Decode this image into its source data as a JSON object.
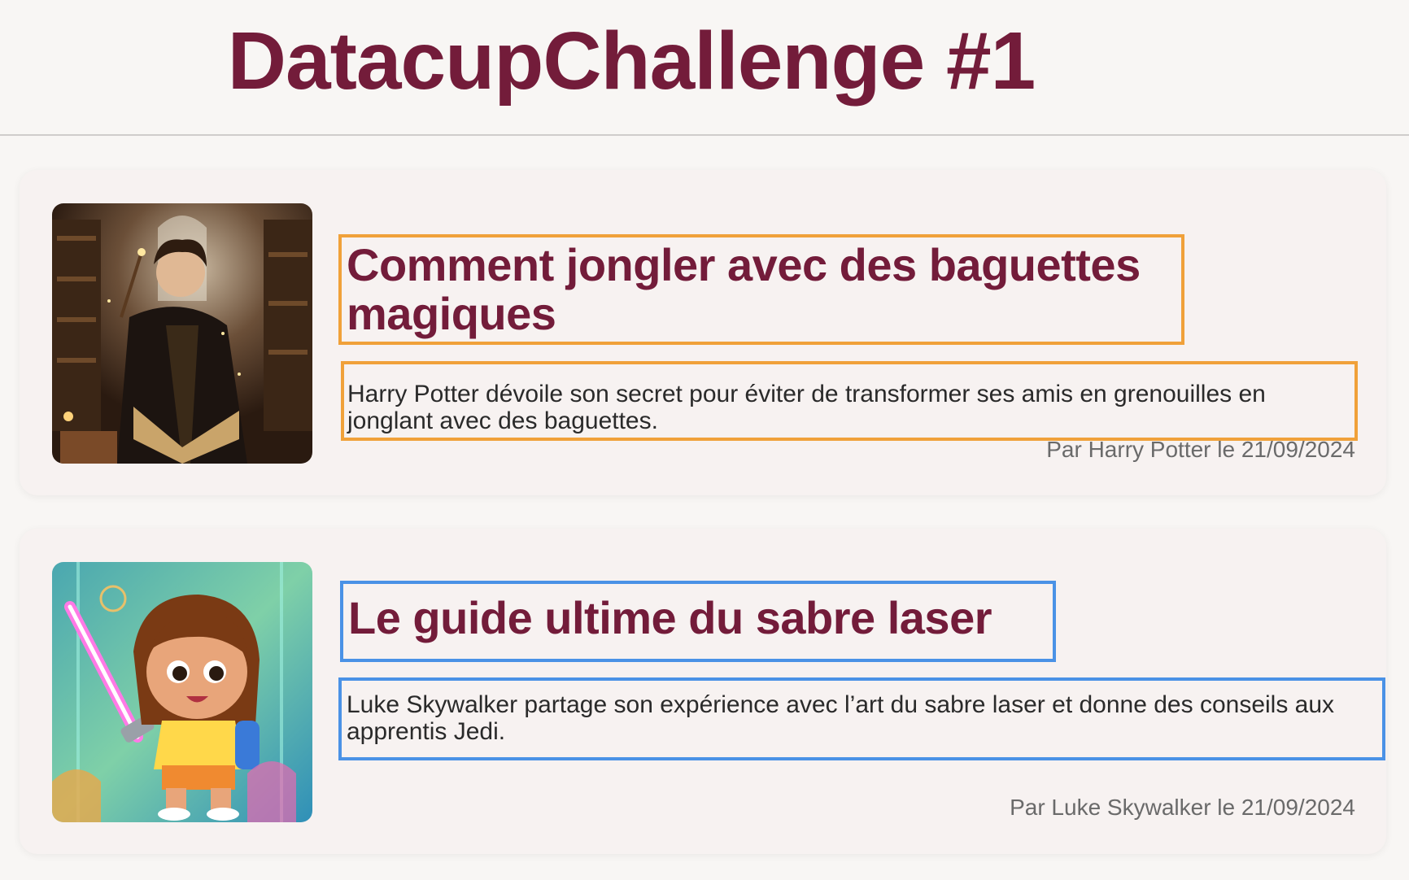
{
  "header": {
    "title": "DatacupChallenge #1"
  },
  "articles": [
    {
      "title": "Comment jongler avec des baguettes magiques",
      "description": "Harry Potter dévoile son secret pour éviter de transformer ses amis en grenouilles en jonglant avec des baguettes.",
      "byline": "Par Harry Potter le 21/09/2024",
      "image": "wizard-boy-library-illustration",
      "highlight_color": "#f0a13a"
    },
    {
      "title": "Le guide ultime du sabre laser",
      "description": "Luke Skywalker partage son expérience avec l’art du sabre laser et donne des conseils aux apprentis Jedi.",
      "byline": "Par Luke Skywalker le 21/09/2024",
      "image": "cartoon-girl-lightsaber-illustration",
      "highlight_color": "#4a92e6"
    }
  ],
  "colors": {
    "accent": "#731c3a",
    "background": "#f8f6f4",
    "card": "#f7f2f1"
  }
}
